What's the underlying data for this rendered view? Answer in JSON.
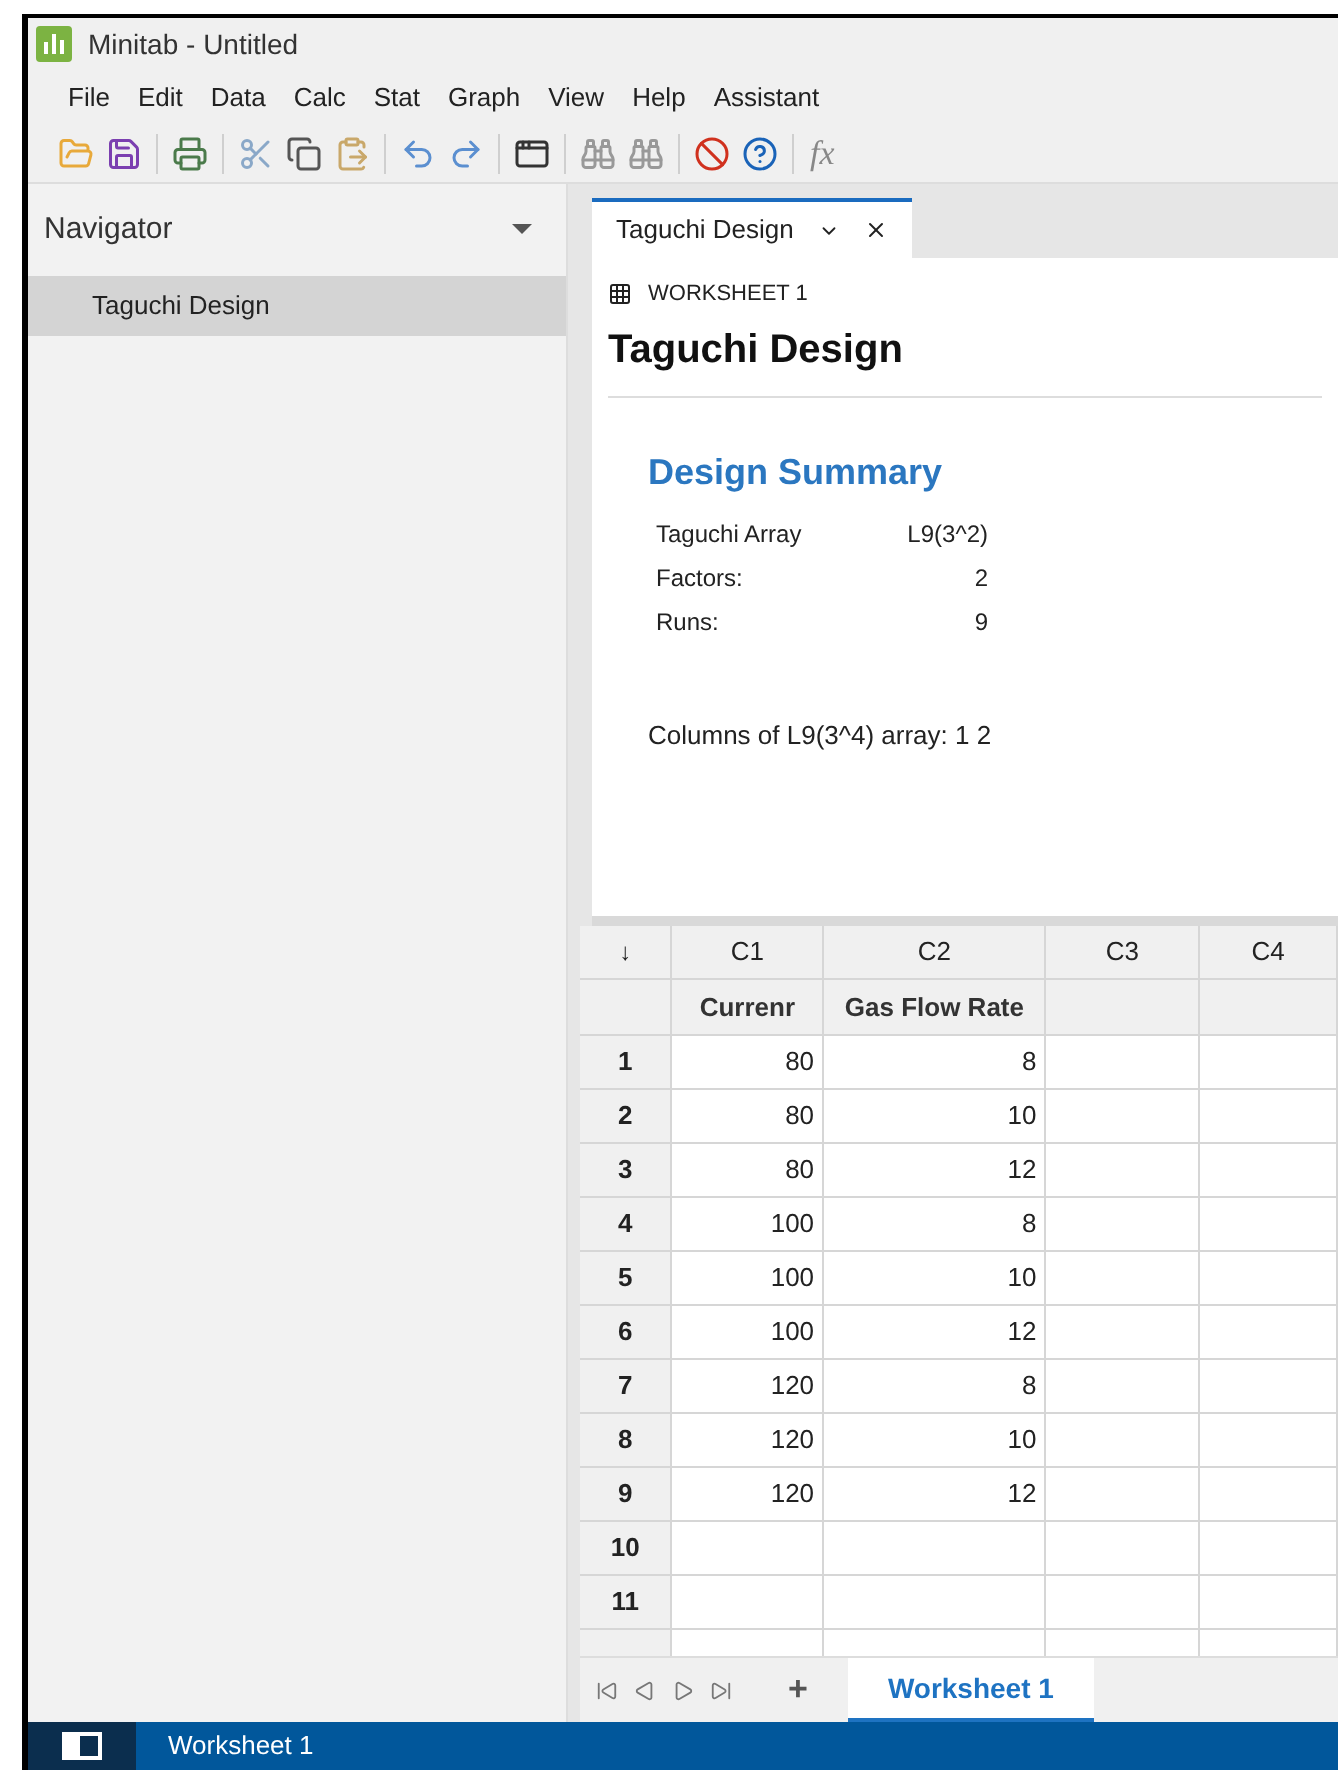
{
  "window": {
    "title": "Minitab - Untitled"
  },
  "toolbar": {
    "formula": "fx"
  },
  "menu": [
    "File",
    "Edit",
    "Data",
    "Calc",
    "Stat",
    "Graph",
    "View",
    "Help",
    "Assistant"
  ],
  "navigator": {
    "title": "Navigator",
    "items": [
      {
        "label": "Taguchi Design",
        "selected": true
      }
    ]
  },
  "output_tab": {
    "label": "Taguchi Design",
    "selected": true
  },
  "output": {
    "worksheet": "WORKSHEET 1",
    "title": "Taguchi Design",
    "section": "Design Summary",
    "summary": [
      [
        "Taguchi Array",
        "L9(3^2)"
      ],
      [
        "Factors:",
        "2"
      ],
      [
        "Runs:",
        "9"
      ]
    ],
    "note": "Columns of L9(3^4) array: 1 2"
  },
  "grid": {
    "corner": "↓",
    "columns": [
      "C1",
      "C2",
      "C3",
      "C4"
    ],
    "names": [
      "Currenr",
      "Gas Flow Rate"
    ],
    "rows": [
      {
        "n": "1",
        "c": [
          "80",
          "8"
        ]
      },
      {
        "n": "2",
        "c": [
          "80",
          "10"
        ]
      },
      {
        "n": "3",
        "c": [
          "80",
          "12"
        ]
      },
      {
        "n": "4",
        "c": [
          "100",
          "8"
        ]
      },
      {
        "n": "5",
        "c": [
          "100",
          "10"
        ]
      },
      {
        "n": "6",
        "c": [
          "100",
          "12"
        ]
      },
      {
        "n": "7",
        "c": [
          "120",
          "8"
        ]
      },
      {
        "n": "8",
        "c": [
          "120",
          "10"
        ]
      },
      {
        "n": "9",
        "c": [
          "120",
          "12"
        ]
      },
      {
        "n": "10",
        "c": []
      },
      {
        "n": "11",
        "c": []
      }
    ]
  },
  "sheet_tabs": {
    "add": "+",
    "tabs": [
      {
        "label": "Worksheet 1",
        "selected": true
      }
    ]
  },
  "status_bar": {
    "label": "Worksheet 1"
  }
}
